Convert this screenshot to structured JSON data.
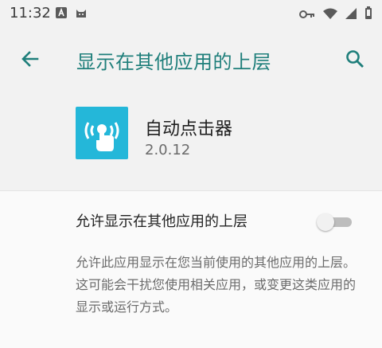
{
  "status_bar": {
    "time": "11:32",
    "left_icons": [
      "a-letter-icon",
      "cat-icon"
    ],
    "right_icons": [
      "key-icon",
      "wifi-icon",
      "signal-icon",
      "battery-icon"
    ]
  },
  "app_bar": {
    "title": "显示在其他应用的上层",
    "back_icon": "arrow-left-icon",
    "search_icon": "search-icon",
    "accent_color": "#1f7f7b"
  },
  "app_info": {
    "name": "自动点击器",
    "version": "2.0.12",
    "icon_color": "#24b7d9"
  },
  "setting": {
    "label": "允许显示在其他应用的上层",
    "enabled": false
  },
  "description": {
    "text": "允许此应用显示在您当前使用的其他应用的上层。这可能会干扰您使用相关应用，或变更这类应用的显示或运行方式。"
  }
}
